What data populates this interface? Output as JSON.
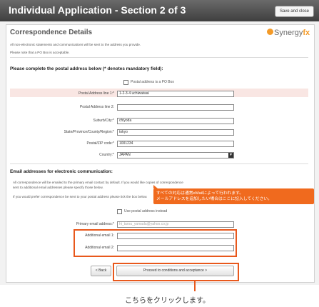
{
  "window": {
    "title": "Individual Application - Section 2 of 3",
    "save_close": "Save and close"
  },
  "page": {
    "heading": "Correspondence Details",
    "logo_text": "Synergy",
    "logo_accent": "fx",
    "intro1": "All non-electronic statements and communications will be sent to the address you provide.",
    "intro2": "Please note that a PO Box is acceptable."
  },
  "postal": {
    "section_title": "Please complete the postal address below (* denotes mandatory field):",
    "po_box_label": "Postal address is a PO Box",
    "fields": [
      {
        "label": "Postal Address line 1:*",
        "value": "1-2-3-4 uchiwaiwai"
      },
      {
        "label": "Postal Address line 2:",
        "value": ""
      },
      {
        "label": "Suburb/City:*",
        "value": "chiyoda"
      },
      {
        "label": "State/Province/County/Region:*",
        "value": "tokyo"
      },
      {
        "label": "Postal/ZIP code:*",
        "value": "1001234"
      },
      {
        "label": "Country:*",
        "value": "JAPAN"
      }
    ]
  },
  "email": {
    "section_title": "Email addresses for electronic communication:",
    "note1": "All correspondence will be emailed to the primary email contact by default. If you would like copies of correspondence",
    "note2": "sent to additional email addresses please specify those below.",
    "note3": "If you would prefer correspondence be sent to your postal address please tick the box below.",
    "use_postal_label": "Use postal address instead",
    "primary_label": "Primary email address:*",
    "primary_placeholder": "hi_tarou_yamada@yahoo.co.jp",
    "additional1_label": "Additional email 1:",
    "additional2_label": "Additional email 2:"
  },
  "callout": {
    "line1": "すべての対応は通常eMailによって行われます。",
    "line2": "メールアドレスを追加したい場合はここに記入してください。"
  },
  "buttons": {
    "back": "< Back",
    "proceed": "Proceed to conditions and acceptance >"
  },
  "caption": "こちらをクリックします。",
  "colors": {
    "accent": "#e8581c",
    "logo": "#f39a28"
  }
}
